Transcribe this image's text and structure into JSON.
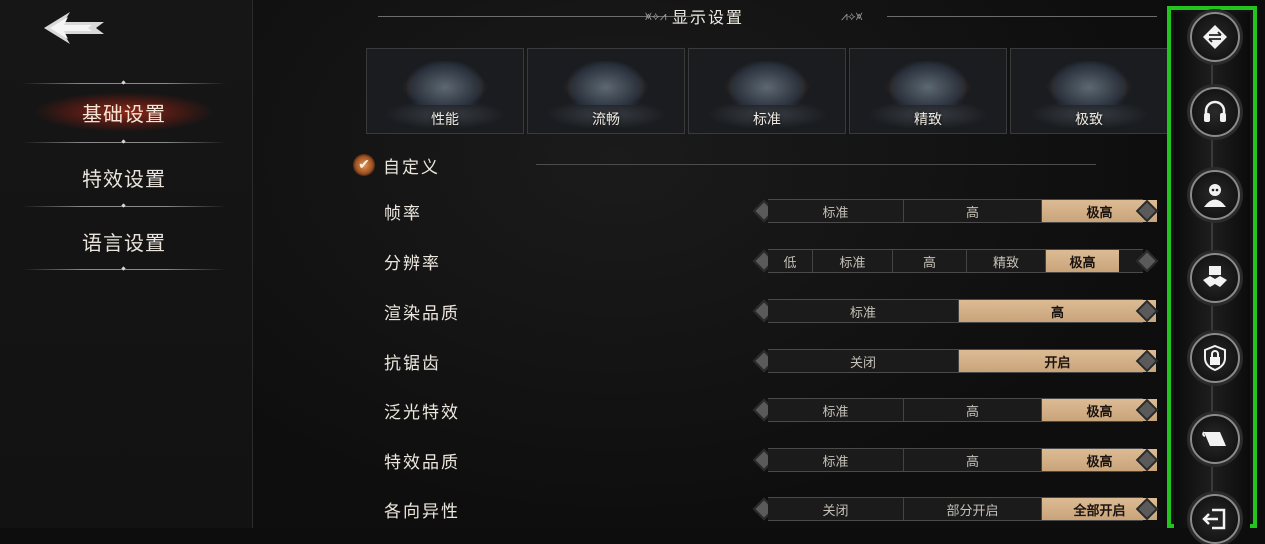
{
  "sidebar": {
    "items": [
      {
        "label": "基础设置",
        "active": true
      },
      {
        "label": "特效设置",
        "active": false
      },
      {
        "label": "语言设置",
        "active": false
      }
    ]
  },
  "main": {
    "title": "显示设置",
    "presets": [
      "性能",
      "流畅",
      "标准",
      "精致",
      "极致"
    ],
    "custom_label": "自定义",
    "settings": [
      {
        "label": "帧率",
        "options": [
          "标准",
          "高",
          "极高"
        ],
        "selected": "极高"
      },
      {
        "label": "分辨率",
        "options": [
          "低",
          "标准",
          "高",
          "精致",
          "极高"
        ],
        "selected": "极高"
      },
      {
        "label": "渲染品质",
        "options": [
          "标准",
          "高"
        ],
        "selected": "高"
      },
      {
        "label": "抗锯齿",
        "options": [
          "关闭",
          "开启"
        ],
        "selected": "开启"
      },
      {
        "label": "泛光特效",
        "options": [
          "标准",
          "高",
          "极高"
        ],
        "selected": "极高"
      },
      {
        "label": "特效品质",
        "options": [
          "标准",
          "高",
          "极高"
        ],
        "selected": "极高"
      },
      {
        "label": "各向异性",
        "options": [
          "关闭",
          "部分开启",
          "全部开启"
        ],
        "selected": "全部开启"
      }
    ]
  },
  "right_bar": {
    "icons": [
      "display-settings-icon",
      "headphones-icon",
      "character-icon",
      "handshake-icon",
      "lock-shield-icon",
      "scroll-icon",
      "exit-icon"
    ],
    "highlight_color": "#22c51e"
  },
  "colors": {
    "accent_selected": "#d4b38c",
    "active_nav_glow": "#96281a"
  }
}
